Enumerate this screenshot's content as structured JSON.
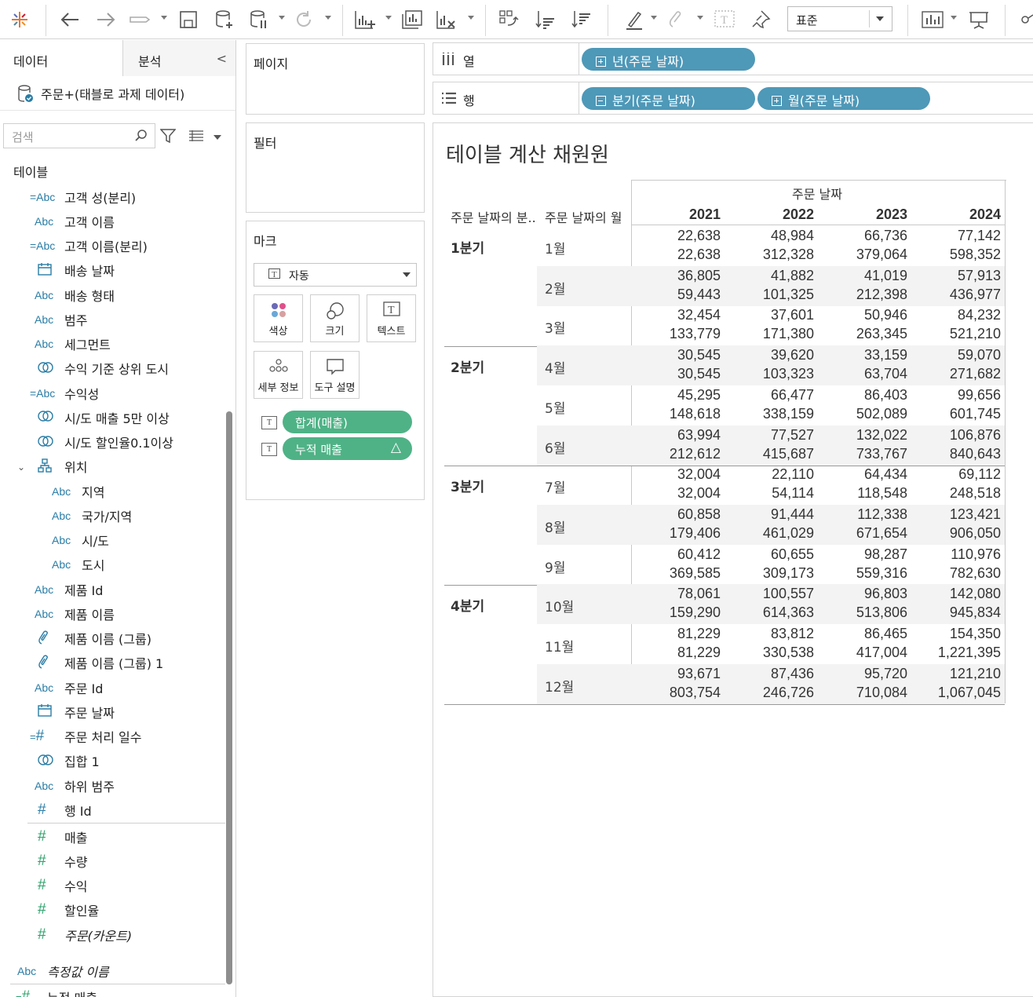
{
  "toolbar": {
    "fit_mode": "표준",
    "icons": [
      "tableau-logo-icon",
      "undo-icon",
      "redo-icon",
      "replay-icon",
      "save-icon",
      "new-datasource-icon",
      "pause-update-icon",
      "refresh-icon",
      "new-sheet-icon",
      "duplicate-sheet-icon",
      "clear-sheet-icon",
      "swap-icon",
      "sort-ascending-icon",
      "sort-descending-icon",
      "highlight-icon",
      "group-icon",
      "label-icon",
      "pin-icon",
      "show-me-icon",
      "presentation-icon",
      "share-icon"
    ]
  },
  "left_pane": {
    "tab_data": "데이터",
    "tab_analysis": "분석",
    "collapse": "<",
    "datasource": "주문+(태블로 과제 데이터)",
    "search_placeholder": "검색",
    "tables_header": "테이블",
    "fields": [
      {
        "icon": "=Abc",
        "label": "고객 성(분리)",
        "indent": 0
      },
      {
        "icon": "Abc",
        "label": "고객 이름",
        "indent": 0
      },
      {
        "icon": "=Abc",
        "label": "고객 이름(분리)",
        "indent": 0
      },
      {
        "icon": "calendar",
        "label": "배송 날짜",
        "indent": 0
      },
      {
        "icon": "Abc",
        "label": "배송 형태",
        "indent": 0
      },
      {
        "icon": "Abc",
        "label": "범주",
        "indent": 0
      },
      {
        "icon": "Abc",
        "label": "세그먼트",
        "indent": 0
      },
      {
        "icon": "set",
        "label": "수익 기준 상위 도시",
        "indent": 0
      },
      {
        "icon": "=Abc",
        "label": "수익성",
        "indent": 0
      },
      {
        "icon": "set",
        "label": "시/도 매출 5만 이상",
        "indent": 0
      },
      {
        "icon": "set",
        "label": "시/도 할인율0.1이상",
        "indent": 0
      },
      {
        "icon": "hierarchy",
        "label": "위치",
        "indent": 0
      },
      {
        "icon": "Abc",
        "label": "지역",
        "indent": 1
      },
      {
        "icon": "Abc",
        "label": "국가/지역",
        "indent": 1
      },
      {
        "icon": "Abc",
        "label": "시/도",
        "indent": 1
      },
      {
        "icon": "Abc",
        "label": "도시",
        "indent": 1
      },
      {
        "icon": "Abc",
        "label": "제품 Id",
        "indent": 0
      },
      {
        "icon": "Abc",
        "label": "제품 이름",
        "indent": 0
      },
      {
        "icon": "clip",
        "label": "제품 이름 (그룹)",
        "indent": 0
      },
      {
        "icon": "clip",
        "label": "제품 이름 (그룹) 1",
        "indent": 0
      },
      {
        "icon": "Abc",
        "label": "주문 Id",
        "indent": 0
      },
      {
        "icon": "calendar",
        "label": "주문 날짜",
        "indent": 0
      },
      {
        "icon": "=#",
        "label": "주문 처리 일수",
        "indent": 0
      },
      {
        "icon": "set",
        "label": "집합 1",
        "indent": 0
      },
      {
        "icon": "Abc",
        "label": "하위 범주",
        "indent": 0
      },
      {
        "icon": "#",
        "label": "행 Id",
        "indent": 0
      }
    ],
    "measures": [
      {
        "icon": "#",
        "label": "매출",
        "italic": false
      },
      {
        "icon": "#",
        "label": "수량",
        "italic": false
      },
      {
        "icon": "#",
        "label": "수익",
        "italic": false
      },
      {
        "icon": "#",
        "label": "할인율",
        "italic": false
      },
      {
        "icon": "#",
        "label": "주문(카운트)",
        "italic": true
      }
    ],
    "extra": {
      "icon": "Abc",
      "label": "측정값 이름"
    },
    "cut_off": {
      "icon": "=#",
      "label": "누적 매출"
    }
  },
  "cards": {
    "pages": "페이지",
    "filters": "필터",
    "marks": "마크",
    "mark_type": "자동",
    "buttons": [
      "색상",
      "크기",
      "텍스트",
      "세부 정보",
      "도구 설명"
    ],
    "mark_pills": [
      {
        "label": "합계(매출)",
        "delta": ""
      },
      {
        "label": "누적 매출",
        "delta": "△"
      }
    ]
  },
  "shelves": {
    "columns_label": "열",
    "rows_label": "행",
    "columns_pills": [
      "년(주문 날짜)"
    ],
    "rows_pills": [
      "분기(주문 날짜)",
      "월(주문 날짜)"
    ]
  },
  "view": {
    "title": "테이블 계산 채원원",
    "col_group_header": "주문 날짜",
    "row_header_1": "주문 날짜의 분..",
    "row_header_2": "주문 날짜의 월",
    "years": [
      "2021",
      "2022",
      "2023",
      "2024"
    ],
    "quarters": [
      {
        "label": "1분기",
        "months": [
          {
            "label": "1월",
            "sales": [
              "22,638",
              "48,984",
              "66,736",
              "77,142"
            ],
            "running": [
              "22,638",
              "312,328",
              "379,064",
              "598,352"
            ]
          },
          {
            "label": "2월",
            "sales": [
              "36,805",
              "41,882",
              "41,019",
              "57,913"
            ],
            "running": [
              "59,443",
              "101,325",
              "212,398",
              "436,977"
            ]
          },
          {
            "label": "3월",
            "sales": [
              "32,454",
              "37,601",
              "50,946",
              "84,232"
            ],
            "running": [
              "133,779",
              "171,380",
              "263,345",
              "521,210"
            ]
          }
        ]
      },
      {
        "label": "2분기",
        "months": [
          {
            "label": "4월",
            "sales": [
              "30,545",
              "39,620",
              "33,159",
              "59,070"
            ],
            "running": [
              "30,545",
              "103,323",
              "63,704",
              "271,682"
            ]
          },
          {
            "label": "5월",
            "sales": [
              "45,295",
              "66,477",
              "86,403",
              "99,656"
            ],
            "running": [
              "148,618",
              "338,159",
              "502,089",
              "601,745"
            ]
          },
          {
            "label": "6월",
            "sales": [
              "63,994",
              "77,527",
              "132,022",
              "106,876"
            ],
            "running": [
              "212,612",
              "415,687",
              "733,767",
              "840,643"
            ]
          }
        ]
      },
      {
        "label": "3분기",
        "months": [
          {
            "label": "7월",
            "sales": [
              "32,004",
              "22,110",
              "64,434",
              "69,112"
            ],
            "running": [
              "32,004",
              "54,114",
              "118,548",
              "248,518"
            ]
          },
          {
            "label": "8월",
            "sales": [
              "60,858",
              "91,444",
              "112,338",
              "123,421"
            ],
            "running": [
              "179,406",
              "461,029",
              "671,654",
              "906,050"
            ]
          },
          {
            "label": "9월",
            "sales": [
              "60,412",
              "60,655",
              "98,287",
              "110,976"
            ],
            "running": [
              "369,585",
              "309,173",
              "559,316",
              "782,630"
            ]
          }
        ]
      },
      {
        "label": "4분기",
        "months": [
          {
            "label": "10월",
            "sales": [
              "78,061",
              "100,557",
              "96,803",
              "142,080"
            ],
            "running": [
              "159,290",
              "614,363",
              "513,806",
              "945,834"
            ]
          },
          {
            "label": "11월",
            "sales": [
              "81,229",
              "83,812",
              "86,465",
              "154,350"
            ],
            "running": [
              "81,229",
              "330,538",
              "417,004",
              "1,221,395"
            ]
          },
          {
            "label": "12월",
            "sales": [
              "93,671",
              "87,436",
              "95,720",
              "121,210"
            ],
            "running": [
              "803,754",
              "246,726",
              "710,084",
              "1,067,045"
            ]
          }
        ]
      }
    ]
  }
}
